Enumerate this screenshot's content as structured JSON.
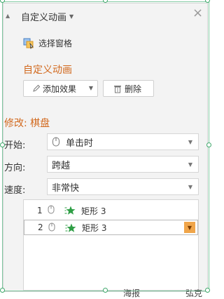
{
  "pane": {
    "title": "自定义动画",
    "select_pane_label": "选择窗格",
    "section_title": "自定义动画",
    "add_effect_label": "添加效果",
    "delete_label": "删除",
    "modify_label": "修改: 棋盘",
    "start": {
      "label": "开始:",
      "value": "单击时"
    },
    "direction": {
      "label": "方向:",
      "value": "跨越"
    },
    "speed": {
      "label": "速度:",
      "value": "非常快"
    },
    "list": [
      {
        "num": "1",
        "text": "矩形 3"
      },
      {
        "num": "2",
        "text": "矩形 3"
      }
    ]
  },
  "behind_text": [
    "海报",
    "弘克"
  ],
  "colors": {
    "accent": "#d2691e",
    "handle": "#3fa86b",
    "star": "#2e9e45",
    "dropdown_highlight": "#f0a54a"
  }
}
